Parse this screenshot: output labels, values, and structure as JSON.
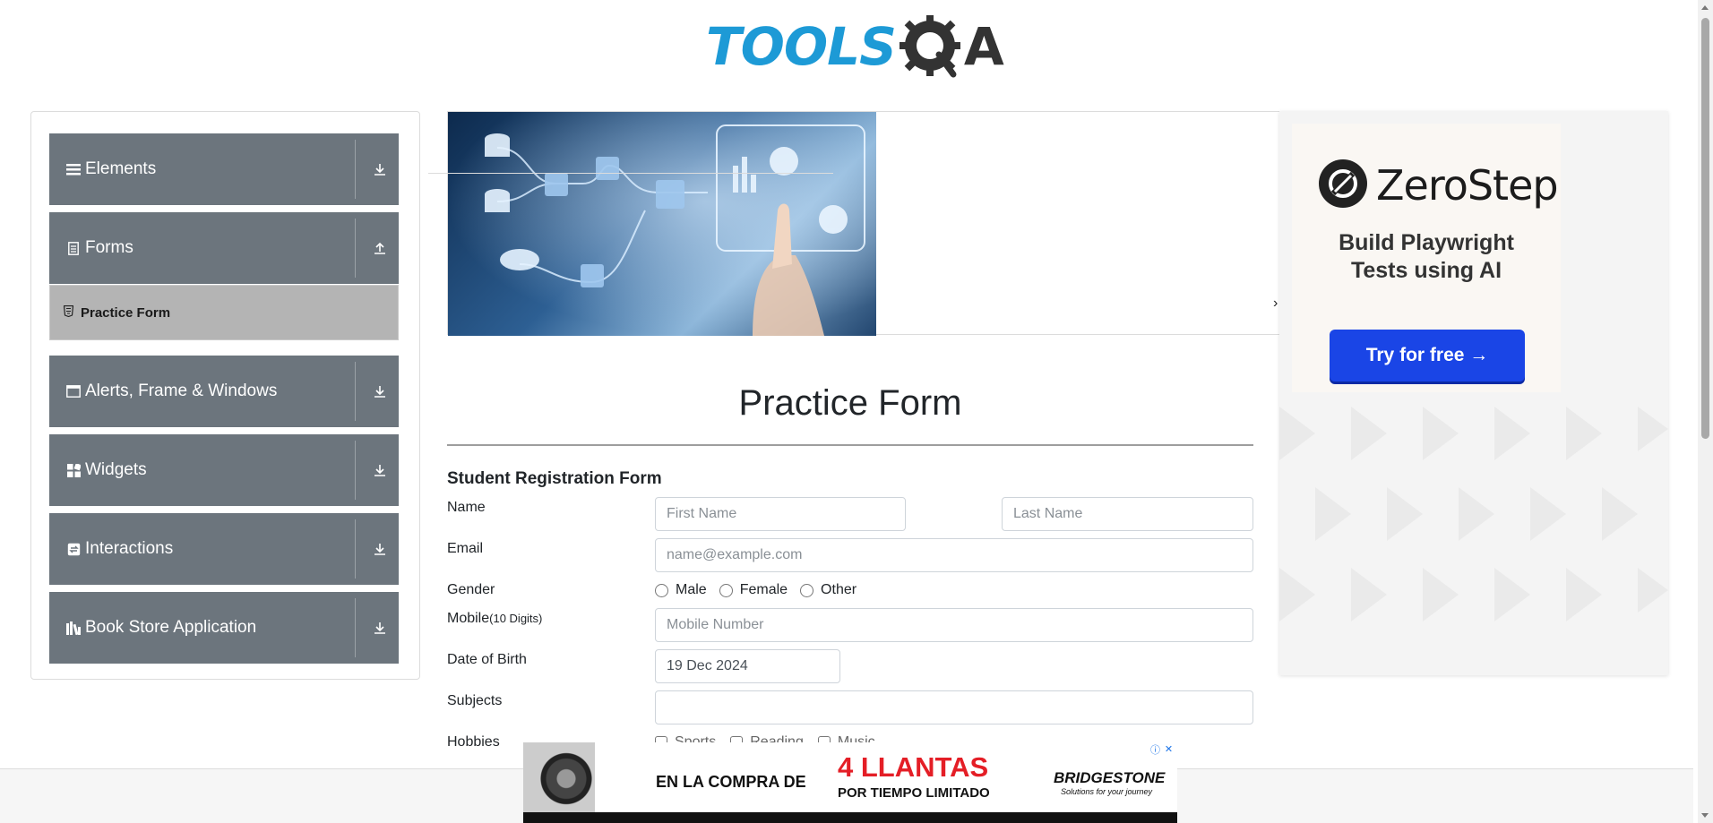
{
  "header": {
    "logo_text": "TOOLS",
    "logo_suffix": "A"
  },
  "sidebar": {
    "groups": [
      {
        "label": "Elements",
        "icon": "list-icon",
        "arrow": "download-arrow-icon"
      },
      {
        "label": "Forms",
        "icon": "doc-icon",
        "arrow": "upload-arrow-icon"
      },
      {
        "label": "Alerts, Frame & Windows",
        "icon": "window-icon",
        "arrow": "download-arrow-icon"
      },
      {
        "label": "Widgets",
        "icon": "widgets-icon",
        "arrow": "download-arrow-icon"
      },
      {
        "label": "Interactions",
        "icon": "interactions-icon",
        "arrow": "download-arrow-icon"
      },
      {
        "label": "Book Store Application",
        "icon": "books-icon",
        "arrow": "download-arrow-icon"
      }
    ],
    "active_item": "Practice Form"
  },
  "ad_right": {
    "brand": "ZeroStep",
    "tagline_line1": "Build Playwright",
    "tagline_line2": "Tests using AI",
    "cta": "Try for free →"
  },
  "form": {
    "title": "Practice Form",
    "subtitle": "Student Registration Form",
    "name_label": "Name",
    "first_name_placeholder": "First Name",
    "last_name_placeholder": "Last Name",
    "email_label": "Email",
    "email_placeholder": "name@example.com",
    "gender_label": "Gender",
    "gender_options": [
      "Male",
      "Female",
      "Other"
    ],
    "mobile_label": "Mobile",
    "mobile_hint": "(10 Digits)",
    "mobile_placeholder": "Mobile Number",
    "dob_label": "Date of Birth",
    "dob_value": "19 Dec 2024",
    "subjects_label": "Subjects",
    "subjects_value": "",
    "hobbies_label": "Hobbies",
    "hobbies_options": [
      "Sports",
      "Reading",
      "Music"
    ]
  },
  "ad_bottom": {
    "left_text": "EN LA COMPRA DE",
    "headline": "4 LLANTAS",
    "subline": "POR TIEMPO LIMITADO",
    "brand": "BRIDGESTONE",
    "brand_tagline": "Solutions for your journey",
    "adchoices": "ⓘ",
    "close": "✕"
  },
  "colors": {
    "sidebar_group": "#6c757d",
    "sidebar_active": "#b4b4b4",
    "logo_blue": "#1d9ad6",
    "cta_blue": "#1a45e6",
    "ad_red": "#e41e26"
  }
}
